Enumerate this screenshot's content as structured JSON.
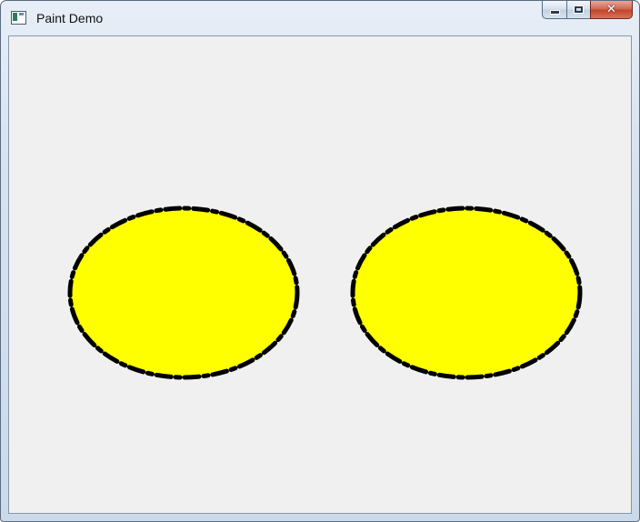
{
  "window": {
    "title": "Paint Demo",
    "app_icon": "window-app-icon",
    "buttons": {
      "minimize": "minimize-icon",
      "maximize": "maximize-icon",
      "close": "close-icon"
    }
  },
  "canvas": {
    "background_color": "#f0f0f0",
    "shapes": [
      {
        "type": "ellipse",
        "fill": "#ffff00",
        "stroke": "#000000",
        "line_style": "dash-dot"
      },
      {
        "type": "ellipse",
        "fill": "#ffff00",
        "stroke": "#000000",
        "line_style": "dash-dot"
      }
    ]
  }
}
